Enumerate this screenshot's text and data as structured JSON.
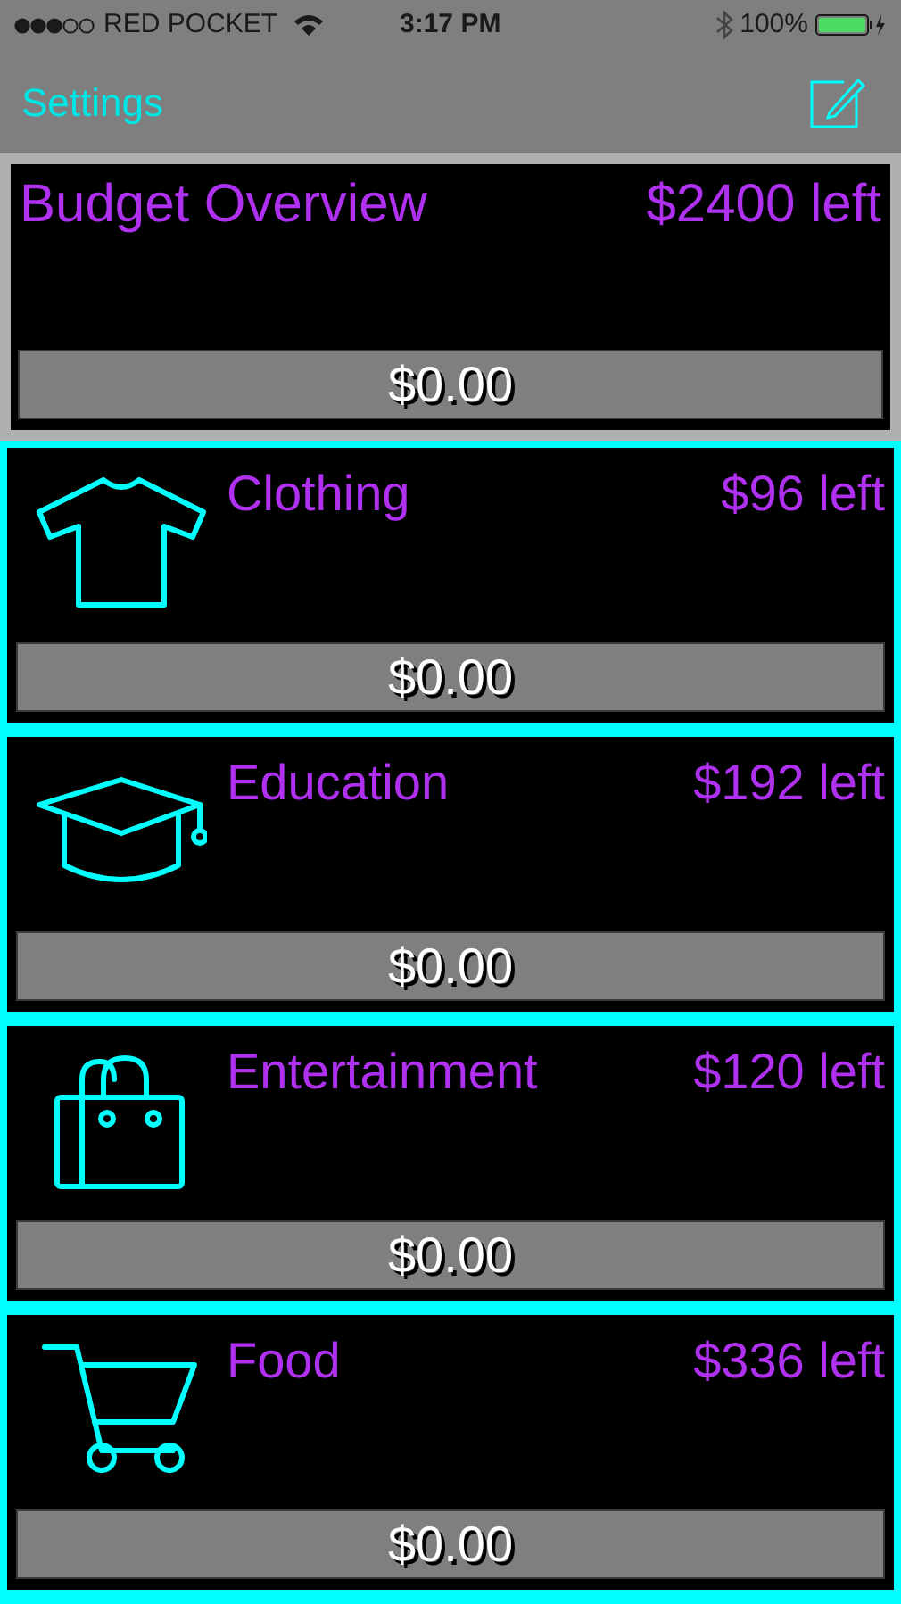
{
  "status_bar": {
    "carrier": "RED POCKET",
    "time": "3:17 PM",
    "battery": "100%"
  },
  "nav_bar": {
    "left_button": "Settings"
  },
  "overview": {
    "title": "Budget Overview",
    "remaining": "$2400 left",
    "spent": "$0.00"
  },
  "categories": [
    {
      "kind": "shirt",
      "name": "Clothing",
      "remaining": "$96 left",
      "spent": "$0.00"
    },
    {
      "kind": "cap",
      "name": "Education",
      "remaining": "$192 left",
      "spent": "$0.00"
    },
    {
      "kind": "bag",
      "name": "Entertainment",
      "remaining": "$120 left",
      "spent": "$0.00"
    },
    {
      "kind": "cart",
      "name": "Food",
      "remaining": "$336 left",
      "spent": "$0.00"
    }
  ]
}
